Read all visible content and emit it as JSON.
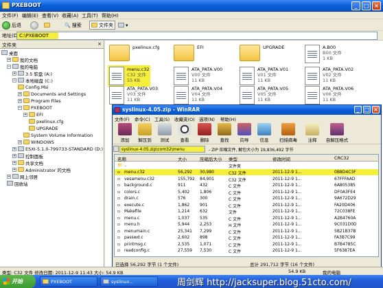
{
  "window": {
    "title": "PXEBOOT"
  },
  "menu": [
    "文件(F)",
    "编辑(E)",
    "查看(V)",
    "收藏(A)",
    "工具(T)",
    "帮助(H)"
  ],
  "toolbar": {
    "back": "后退",
    "search": "搜索",
    "folders": "文件夹"
  },
  "address": {
    "label": "地址(D)",
    "value": "C:\\PXEBOOT",
    "go": "转到"
  },
  "sidebar": {
    "title": "文件夹",
    "items": [
      "桌面",
      "我的文档",
      "我的电脑",
      "3.5 软盘 (A:)",
      "本地磁盘 (C:)",
      "Config.Msi",
      "Documents and Settings",
      "Program Files",
      "PXEBOOT",
      "EFI",
      "pxelinux.cfg",
      "UPGRADE",
      "System Volume Information",
      "WINDOWS",
      "ESXI-5.1.0-799733-STANDARD (D:)",
      "控制面板",
      "共享文档",
      "Administrator 的文档",
      "网上邻居",
      "回收站"
    ]
  },
  "files": [
    {
      "name": "pxelinux.cfg",
      "info": ""
    },
    {
      "name": "EFI",
      "info": ""
    },
    {
      "name": "UPGRADE",
      "info": ""
    },
    {
      "name": "A.B00",
      "info": "B00 文件",
      "size": "1 KB"
    },
    {
      "name": "menu.c32",
      "info": "C32 文件",
      "size": "55 KB"
    },
    {
      "name": "ATA_PATA.V00",
      "info": "V00 文件",
      "size": "11 KB"
    },
    {
      "name": "ATA_PATA.V01",
      "info": "V01 文件",
      "size": "11 KB"
    },
    {
      "name": "ATA_PATA.V02",
      "info": "V02 文件",
      "size": "11 KB"
    },
    {
      "name": "ATA_PATA.V03",
      "info": "V03 文件",
      "size": "11 KB"
    },
    {
      "name": "ATA_PATA.V04",
      "info": "V04 文件",
      "size": "11 KB"
    },
    {
      "name": "ATA_PATA.V05",
      "info": "V05 文件",
      "size": "11 KB"
    },
    {
      "name": "ATA_PATA.V06",
      "info": "V06 文件",
      "size": "11 KB"
    }
  ],
  "rar": {
    "title": "syslinux-4.05.zip - WinRAR",
    "menu": [
      "文件(F)",
      "命令(C)",
      "工具(S)",
      "收藏夹(O)",
      "选项(N)",
      "帮助(H)"
    ],
    "tools": [
      "添加",
      "解压到",
      "测试",
      "查看",
      "删除",
      "查找",
      "向导",
      "信息",
      "扫描病毒",
      "注释",
      "自解压格式"
    ],
    "path": "syslinux-4.05.zip\\com32\\menu",
    "path_info": "- ZIP 压缩文件, 解包大小为 19,836,492 字节",
    "columns": [
      "名称",
      "大小",
      "压缩后大小",
      "类型",
      "修改时间",
      "CRC32"
    ],
    "parent": "..",
    "parent_type": "文件夹",
    "rows": [
      {
        "name": "menu.c32",
        "size": "56,292",
        "packed": "30,980",
        "type": "C32 文件",
        "time": "2011-12-9 1...",
        "crc": "0B8D4C3F"
      },
      {
        "name": "vesamenu.c32",
        "size": "155,792",
        "packed": "84,901",
        "type": "C32 文件",
        "time": "2011-12-9 1...",
        "crc": "67FFFAAD"
      },
      {
        "name": "background.c",
        "size": "911",
        "packed": "432",
        "type": "C 文件",
        "time": "2011-12-9 1...",
        "crc": "6A805385"
      },
      {
        "name": "colors.c",
        "size": "5,402",
        "packed": "1,806",
        "type": "C 文件",
        "time": "2011-12-9 1...",
        "crc": "DF0A3FE4"
      },
      {
        "name": "drain.c",
        "size": "576",
        "packed": "300",
        "type": "C 文件",
        "time": "2011-12-9 1...",
        "crc": "9A672D29"
      },
      {
        "name": "execute.c",
        "size": "1,862",
        "packed": "901",
        "type": "C 文件",
        "time": "2011-12-9 1...",
        "crc": "FA20D406"
      },
      {
        "name": "Makefile",
        "size": "1,214",
        "packed": "632",
        "type": "文件",
        "time": "2011-12-9 1...",
        "crc": "72C038FE"
      },
      {
        "name": "menu.c",
        "size": "1,037",
        "packed": "535",
        "type": "C 文件",
        "time": "2011-12-9 1...",
        "crc": "A2B4760A"
      },
      {
        "name": "menu.h",
        "size": "5,944",
        "packed": "2,253",
        "type": "H 文件",
        "time": "2011-12-9 1...",
        "crc": "9C031D0D"
      },
      {
        "name": "menumain.c",
        "size": "25,341",
        "packed": "7,299",
        "type": "C 文件",
        "time": "2011-12-9 1...",
        "crc": "5B21B37B"
      },
      {
        "name": "passwd.c",
        "size": "2,602",
        "packed": "898",
        "type": "C 文件",
        "time": "2011-12-9 1...",
        "crc": "FA3B7C99"
      },
      {
        "name": "printmsg.c",
        "size": "2,535",
        "packed": "1,071",
        "type": "C 文件",
        "time": "2011-12-9 1...",
        "crc": "B7B4785C"
      },
      {
        "name": "readconfig.c",
        "size": "27,559",
        "packed": "7,530",
        "type": "C 文件",
        "time": "2011-12-9 1...",
        "crc": "5F6387EA"
      }
    ],
    "status_left": "已选择 56,292 字节 (1 个文件)",
    "status_right": "总计 291,712 字节 (16 个文件)"
  },
  "status": {
    "left": "类型: C32 文件 修改日期: 2011-12-9 11:43 大小: 54.9 KB",
    "size": "54.9 KB",
    "zone": "我的电脑"
  },
  "taskbar": {
    "start": "开始",
    "tasks": [
      "PXEBOOT",
      "syslinux..."
    ]
  },
  "watermark": "周剑辉 http://jacksuper.blog.51cto.com/"
}
